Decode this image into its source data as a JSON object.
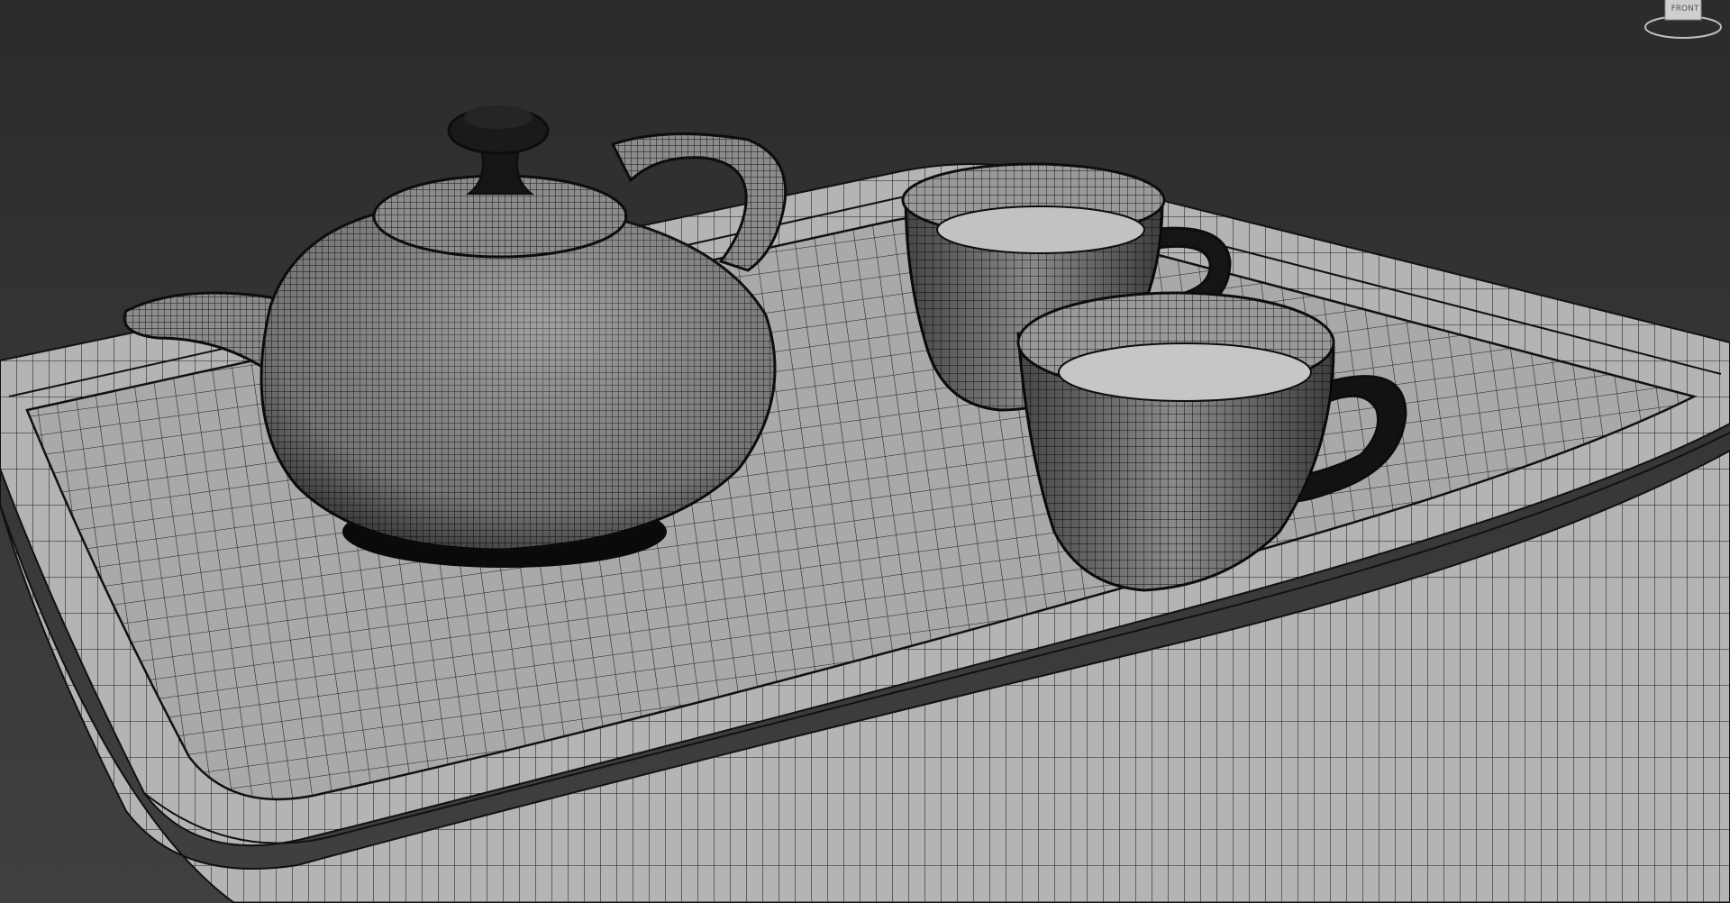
{
  "viewport": {
    "background_top": "#2b2b2b",
    "background_bottom": "#404040",
    "shading_mode": "wireframe-over-shaded"
  },
  "scene": {
    "objects": [
      "tray",
      "teapot",
      "teacup-back",
      "teacup-front"
    ],
    "wire_color": "#111111",
    "surface_color": "#a8a8a8"
  },
  "viewcube": {
    "face_label": "FRONT",
    "icon": "viewcube-icon"
  }
}
